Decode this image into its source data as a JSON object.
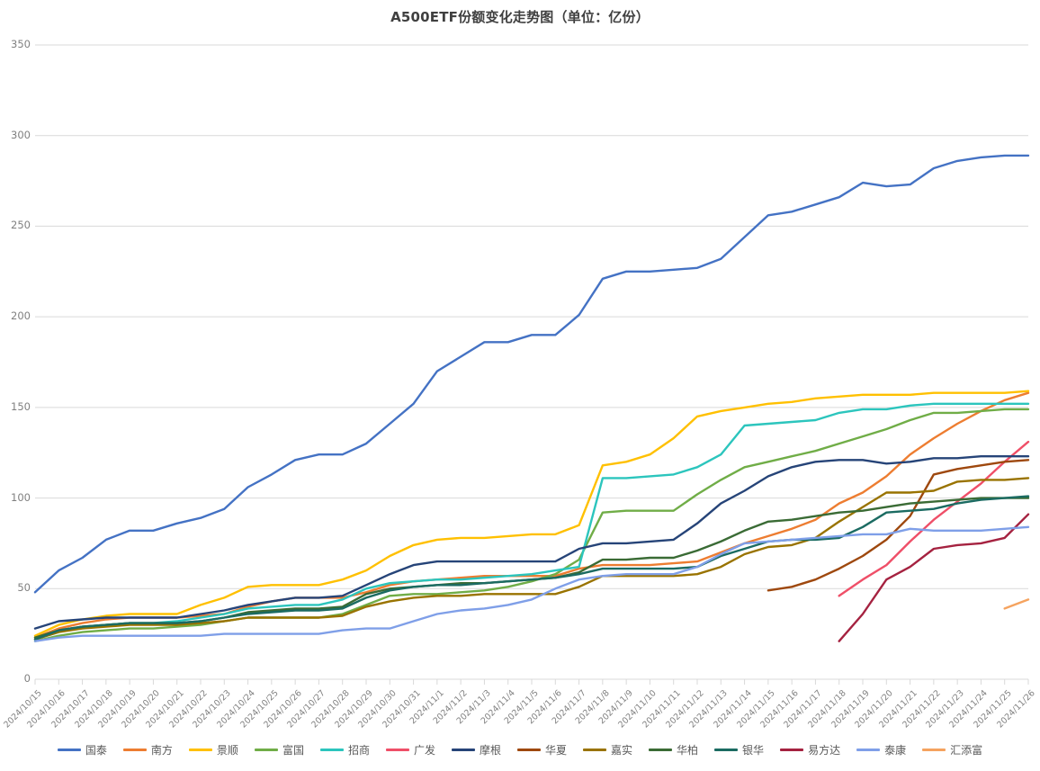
{
  "chart_data": {
    "type": "line",
    "title": "A500ETF份额变化走势图（单位：亿份）",
    "xlabel": "",
    "ylabel": "",
    "ylim": [
      0,
      350
    ],
    "yticks": [
      0,
      50,
      100,
      150,
      200,
      250,
      300,
      350
    ],
    "grid": true,
    "legend_position": "bottom",
    "x": [
      "2024/10/15",
      "2024/10/16",
      "2024/10/17",
      "2024/10/18",
      "2024/10/19",
      "2024/10/20",
      "2024/10/21",
      "2024/10/22",
      "2024/10/23",
      "2024/10/24",
      "2024/10/25",
      "2024/10/26",
      "2024/10/27",
      "2024/10/28",
      "2024/10/29",
      "2024/10/30",
      "2024/10/31",
      "2024/11/1",
      "2024/11/2",
      "2024/11/3",
      "2024/11/4",
      "2024/11/5",
      "2024/11/6",
      "2024/11/7",
      "2024/11/8",
      "2024/11/9",
      "2024/11/10",
      "2024/11/11",
      "2024/11/12",
      "2024/11/13",
      "2024/11/14",
      "2024/11/15",
      "2024/11/16",
      "2024/11/17",
      "2024/11/18",
      "2024/11/19",
      "2024/11/20",
      "2024/11/21",
      "2024/11/22",
      "2024/11/23",
      "2024/11/24",
      "2024/11/25",
      "2024/11/26"
    ],
    "series": [
      {
        "name": "国泰",
        "color": "#4472c4",
        "values": [
          48,
          60,
          67,
          77,
          82,
          82,
          86,
          89,
          94,
          106,
          113,
          121,
          124,
          124,
          130,
          141,
          152,
          170,
          178,
          186,
          186,
          190,
          190,
          201,
          221,
          225,
          225,
          226,
          227,
          232,
          244,
          256,
          258,
          262,
          266,
          274,
          272,
          273,
          282,
          286,
          288,
          289,
          289
        ]
      },
      {
        "name": "南方",
        "color": "#ed7d31",
        "values": [
          23,
          28,
          31,
          33,
          34,
          34,
          34,
          35,
          36,
          40,
          43,
          45,
          45,
          45,
          48,
          52,
          54,
          55,
          56,
          57,
          57,
          57,
          57,
          61,
          63,
          63,
          63,
          64,
          65,
          70,
          75,
          79,
          83,
          88,
          97,
          103,
          112,
          124,
          133,
          141,
          148,
          154,
          158
        ]
      },
      {
        "name": "景顺",
        "color": "#ffc000",
        "values": [
          24,
          30,
          33,
          35,
          36,
          36,
          36,
          41,
          45,
          51,
          52,
          52,
          52,
          55,
          60,
          68,
          74,
          77,
          78,
          78,
          79,
          80,
          80,
          85,
          118,
          120,
          124,
          133,
          145,
          148,
          150,
          152,
          153,
          155,
          156,
          157,
          157,
          157,
          158,
          158,
          158,
          158,
          159
        ]
      },
      {
        "name": "富国",
        "color": "#70ad47",
        "values": [
          21,
          24,
          26,
          27,
          28,
          28,
          29,
          30,
          32,
          34,
          34,
          34,
          34,
          36,
          41,
          46,
          47,
          47,
          48,
          49,
          51,
          54,
          58,
          66,
          92,
          93,
          93,
          93,
          102,
          110,
          117,
          120,
          123,
          126,
          130,
          134,
          138,
          143,
          147,
          147,
          148,
          149,
          149
        ]
      },
      {
        "name": "招商",
        "color": "#2cc5bd",
        "values": [
          22,
          26,
          29,
          30,
          31,
          31,
          32,
          34,
          36,
          39,
          40,
          41,
          41,
          44,
          50,
          53,
          54,
          55,
          55,
          56,
          57,
          58,
          60,
          62,
          111,
          111,
          112,
          113,
          117,
          124,
          140,
          141,
          142,
          143,
          147,
          149,
          149,
          151,
          152,
          152,
          152,
          152,
          152
        ]
      },
      {
        "name": "广发",
        "color": "#ef4f68",
        "values": [
          null,
          null,
          null,
          null,
          null,
          null,
          null,
          null,
          null,
          null,
          null,
          null,
          null,
          null,
          null,
          null,
          null,
          null,
          null,
          null,
          null,
          null,
          null,
          null,
          null,
          null,
          null,
          null,
          null,
          null,
          null,
          null,
          null,
          null,
          46,
          55,
          63,
          76,
          88,
          98,
          108,
          120,
          131
        ]
      },
      {
        "name": "摩根",
        "color": "#264478",
        "values": [
          28,
          32,
          33,
          34,
          34,
          34,
          34,
          36,
          38,
          41,
          43,
          45,
          45,
          46,
          52,
          58,
          63,
          65,
          65,
          65,
          65,
          65,
          65,
          72,
          75,
          75,
          76,
          77,
          86,
          97,
          104,
          112,
          117,
          120,
          121,
          121,
          119,
          120,
          122,
          122,
          123,
          123,
          123
        ]
      },
      {
        "name": "华夏",
        "color": "#9e480e",
        "values": [
          null,
          null,
          null,
          null,
          null,
          null,
          null,
          null,
          null,
          null,
          null,
          null,
          null,
          null,
          null,
          null,
          null,
          null,
          null,
          null,
          null,
          null,
          null,
          null,
          null,
          null,
          null,
          null,
          null,
          null,
          null,
          49,
          51,
          55,
          61,
          68,
          77,
          90,
          113,
          116,
          118,
          120,
          121
        ]
      },
      {
        "name": "嘉实",
        "color": "#997300",
        "values": [
          22,
          26,
          28,
          29,
          30,
          30,
          30,
          31,
          32,
          34,
          34,
          34,
          34,
          35,
          40,
          43,
          45,
          46,
          46,
          47,
          47,
          47,
          47,
          51,
          57,
          57,
          57,
          57,
          58,
          62,
          69,
          73,
          74,
          78,
          87,
          95,
          103,
          103,
          104,
          109,
          110,
          110,
          111
        ]
      },
      {
        "name": "华柏",
        "color": "#3a6b35",
        "values": [
          23,
          27,
          29,
          30,
          31,
          31,
          31,
          32,
          34,
          37,
          38,
          39,
          39,
          40,
          47,
          50,
          51,
          52,
          53,
          53,
          54,
          55,
          56,
          59,
          66,
          66,
          67,
          67,
          71,
          76,
          82,
          87,
          88,
          90,
          92,
          93,
          95,
          97,
          98,
          99,
          100,
          100,
          100
        ]
      },
      {
        "name": "银华",
        "color": "#1b6b62",
        "values": [
          22,
          27,
          29,
          30,
          31,
          31,
          31,
          32,
          34,
          36,
          37,
          38,
          38,
          39,
          45,
          49,
          51,
          52,
          52,
          53,
          54,
          55,
          56,
          58,
          61,
          61,
          61,
          61,
          62,
          68,
          72,
          76,
          77,
          77,
          78,
          84,
          92,
          93,
          94,
          97,
          99,
          100,
          101
        ]
      },
      {
        "name": "易方达",
        "color": "#a52240",
        "values": [
          null,
          null,
          null,
          null,
          null,
          null,
          null,
          null,
          null,
          null,
          null,
          null,
          null,
          null,
          null,
          null,
          null,
          null,
          null,
          null,
          null,
          null,
          null,
          null,
          null,
          null,
          null,
          null,
          null,
          null,
          null,
          null,
          null,
          null,
          21,
          36,
          55,
          62,
          72,
          74,
          75,
          78,
          91
        ]
      },
      {
        "name": "泰康",
        "color": "#7f9fe8",
        "values": [
          21,
          23,
          24,
          24,
          24,
          24,
          24,
          24,
          25,
          25,
          25,
          25,
          25,
          27,
          28,
          28,
          32,
          36,
          38,
          39,
          41,
          44,
          50,
          55,
          57,
          58,
          58,
          58,
          62,
          69,
          75,
          76,
          77,
          78,
          79,
          80,
          80,
          83,
          82,
          82,
          82,
          83,
          84
        ]
      },
      {
        "name": "汇添富",
        "color": "#f5a35f",
        "values": [
          null,
          null,
          null,
          null,
          null,
          null,
          null,
          null,
          null,
          null,
          null,
          null,
          null,
          null,
          null,
          null,
          null,
          null,
          null,
          null,
          null,
          null,
          null,
          null,
          null,
          null,
          null,
          null,
          null,
          null,
          null,
          null,
          null,
          null,
          null,
          null,
          null,
          null,
          null,
          null,
          null,
          39,
          44
        ]
      }
    ]
  },
  "axis": {
    "y_labels": [
      "350",
      "300",
      "250",
      "200",
      "150",
      "100",
      "50",
      "0"
    ],
    "x_labels": [
      "2024/10/15",
      "2024/10/16",
      "2024/10/17",
      "2024/10/18",
      "2024/10/19",
      "2024/10/20",
      "2024/10/21",
      "2024/10/22",
      "2024/10/23",
      "2024/10/24",
      "2024/10/25",
      "2024/10/26",
      "2024/10/27",
      "2024/10/28",
      "2024/10/29",
      "2024/10/30",
      "2024/10/31",
      "2024/11/1",
      "2024/11/2",
      "2024/11/3",
      "2024/11/4",
      "2024/11/5",
      "2024/11/6",
      "2024/11/7",
      "2024/11/8",
      "2024/11/9",
      "2024/11/10",
      "2024/11/11",
      "2024/11/12",
      "2024/11/13",
      "2024/11/14",
      "2024/11/15",
      "2024/11/16",
      "2024/11/17",
      "2024/11/18",
      "2024/11/19",
      "2024/11/20",
      "2024/11/21",
      "2024/11/22",
      "2024/11/23",
      "2024/11/24",
      "2024/11/25",
      "2024/11/26"
    ]
  },
  "legend": {
    "items": [
      {
        "label": "国泰",
        "color": "#4472c4"
      },
      {
        "label": "南方",
        "color": "#ed7d31"
      },
      {
        "label": "景顺",
        "color": "#ffc000"
      },
      {
        "label": "富国",
        "color": "#70ad47"
      },
      {
        "label": "招商",
        "color": "#2cc5bd"
      },
      {
        "label": "广发",
        "color": "#ef4f68"
      },
      {
        "label": "摩根",
        "color": "#264478"
      },
      {
        "label": "华夏",
        "color": "#9e480e"
      },
      {
        "label": "嘉实",
        "color": "#997300"
      },
      {
        "label": "华柏",
        "color": "#3a6b35"
      },
      {
        "label": "银华",
        "color": "#1b6b62"
      },
      {
        "label": "易方达",
        "color": "#a52240"
      },
      {
        "label": "泰康",
        "color": "#7f9fe8"
      },
      {
        "label": "汇添富",
        "color": "#f5a35f"
      }
    ]
  }
}
